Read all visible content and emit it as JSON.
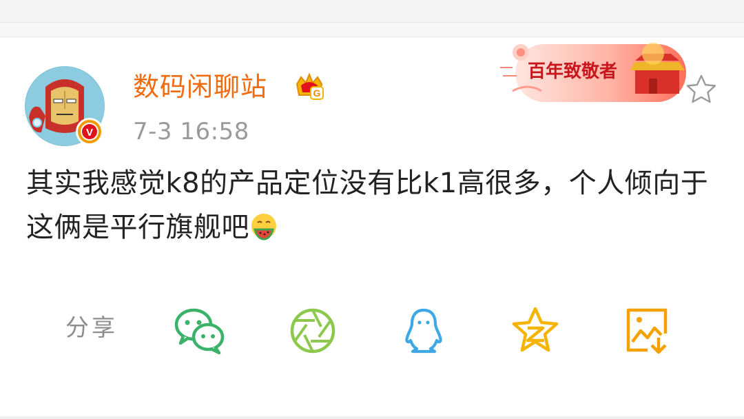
{
  "post": {
    "author": "数码闲聊站",
    "timestamp": "7-3 16:58",
    "text": "其实我感觉k8的产品定位没有比k1高很多，个人倾向于这俩是平行旗舰吧",
    "badge_letter": "V",
    "crown_letter": "G"
  },
  "banner": {
    "text": "百年致敬者"
  },
  "share": {
    "label": "分享",
    "targets": [
      {
        "name": "wechat",
        "icon": "wechat-icon",
        "color": "#3bb26a"
      },
      {
        "name": "moments",
        "icon": "moments-aperture-icon",
        "color": "#8cc84b"
      },
      {
        "name": "qq",
        "icon": "qq-penguin-icon",
        "color": "#3ea8e6"
      },
      {
        "name": "qzone",
        "icon": "qzone-star-icon",
        "color": "#f5b400"
      },
      {
        "name": "save-image",
        "icon": "save-image-icon",
        "color": "#f5a200"
      }
    ]
  },
  "colors": {
    "author": "#f06a10",
    "text": "#222222",
    "timestamp": "#9a9a9a",
    "badge": "#f09b00"
  }
}
